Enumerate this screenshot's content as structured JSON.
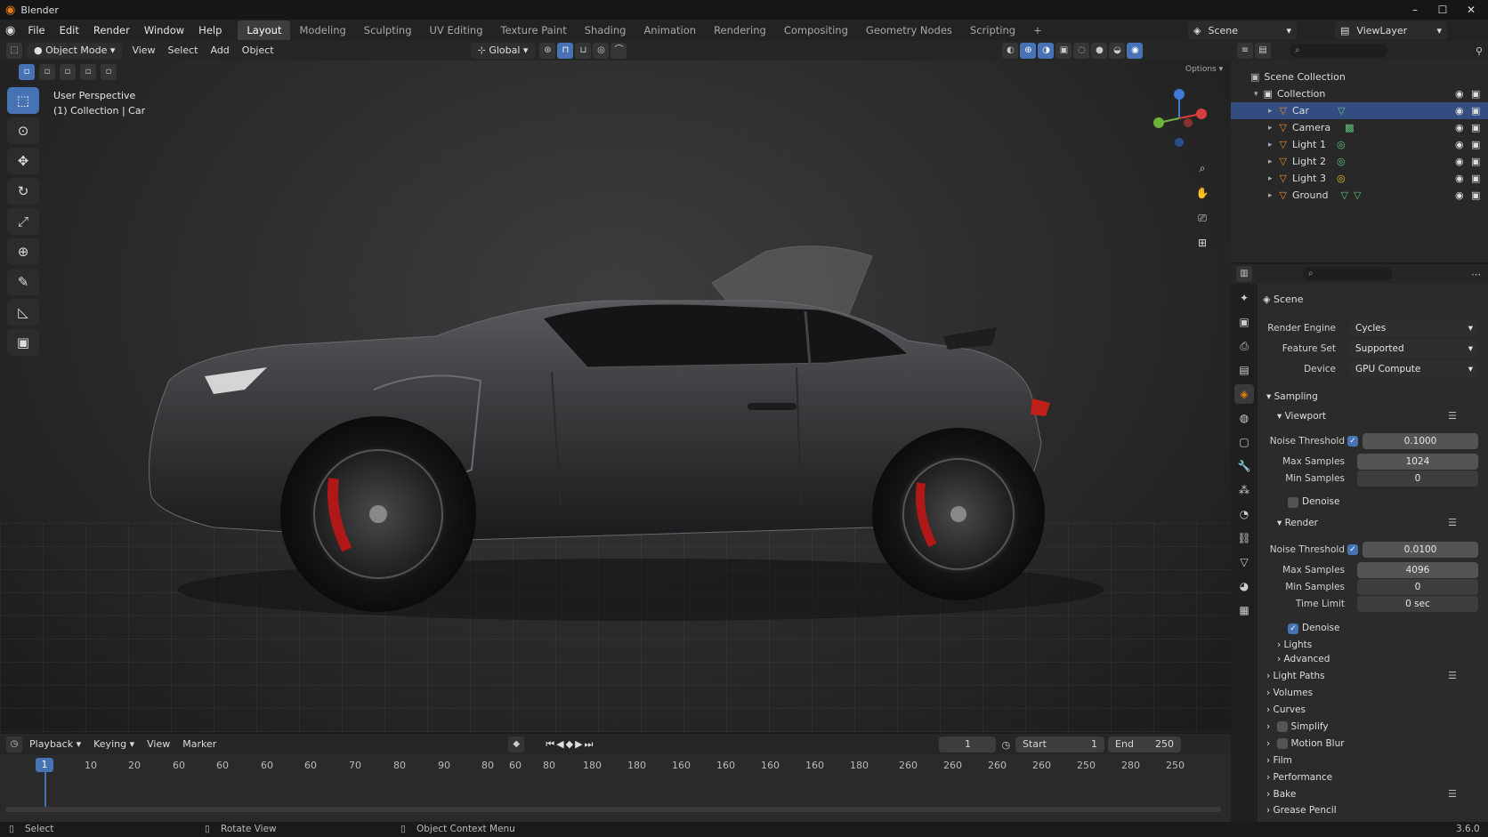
{
  "window": {
    "title": "Blender"
  },
  "menu": [
    "File",
    "Edit",
    "Render",
    "Window",
    "Help"
  ],
  "workspaces": [
    "Layout",
    "Modeling",
    "Sculpting",
    "UV Editing",
    "Texture Paint",
    "Shading",
    "Animation",
    "Rendering",
    "Compositing",
    "Geometry Nodes",
    "Scripting",
    "+"
  ],
  "active_workspace": "Layout",
  "scene_selector": "Scene",
  "viewlayer_selector": "ViewLayer",
  "viewport_header": {
    "mode": "Object Mode",
    "menus": [
      "View",
      "Select",
      "Add",
      "Object"
    ],
    "orientation": "Global"
  },
  "viewport": {
    "perspective_label": "User Perspective",
    "collection_label": "(1) Collection | Car",
    "options_label": "Options"
  },
  "outliner": {
    "root": "Scene Collection",
    "collection": "Collection",
    "items": [
      {
        "name": "Car",
        "selected": true
      },
      {
        "name": "Camera",
        "selected": false
      },
      {
        "name": "Light 1",
        "selected": false
      },
      {
        "name": "Light 2",
        "selected": false
      },
      {
        "name": "Light 3",
        "selected": false
      },
      {
        "name": "Ground",
        "selected": false
      }
    ]
  },
  "properties": {
    "context": "Scene",
    "render_engine_label": "Render Engine",
    "render_engine": "Cycles",
    "feature_set_label": "Feature Set",
    "feature_set": "Supported",
    "device_label": "Device",
    "device": "GPU Compute",
    "sampling": "Sampling",
    "viewport_section": "Viewport",
    "noise_threshold_label": "Noise Threshold",
    "max_samples_label": "Max Samples",
    "min_samples_label": "Min Samples",
    "time_limit_label": "Time Limit",
    "vp_noise_threshold": "0.1000",
    "vp_max_samples": "1024",
    "vp_min_samples": "0",
    "denoise": "Denoise",
    "render_section": "Render",
    "r_noise_threshold": "0.0100",
    "r_max_samples": "4096",
    "r_min_samples": "0",
    "r_time_limit": "0 sec",
    "lights": "Lights",
    "advanced": "Advanced",
    "panels": [
      "Light Paths",
      "Volumes",
      "Curves",
      "Simplify",
      "Motion Blur",
      "Film",
      "Performance",
      "Bake",
      "Grease Pencil"
    ]
  },
  "timeline": {
    "menus": [
      "Playback",
      "Keying",
      "View",
      "Marker"
    ],
    "current_frame": "1",
    "start_label": "Start",
    "start": "1",
    "end_label": "End",
    "end": "250",
    "ruler": [
      "1",
      "10",
      "20",
      "60",
      "60",
      "60",
      "60",
      "70",
      "80",
      "90",
      "80",
      "60",
      "80",
      "180",
      "180",
      "160",
      "160",
      "160",
      "160",
      "180",
      "260",
      "260",
      "260",
      "260",
      "250",
      "280",
      "250"
    ]
  },
  "statusbar": {
    "select": "Select",
    "rotate": "Rotate View",
    "context_menu": "Object Context Menu",
    "version": "3.6.0"
  },
  "colors": {
    "accent": "#4772b3",
    "brand": "#e87d0d",
    "selection": "#334d80"
  }
}
